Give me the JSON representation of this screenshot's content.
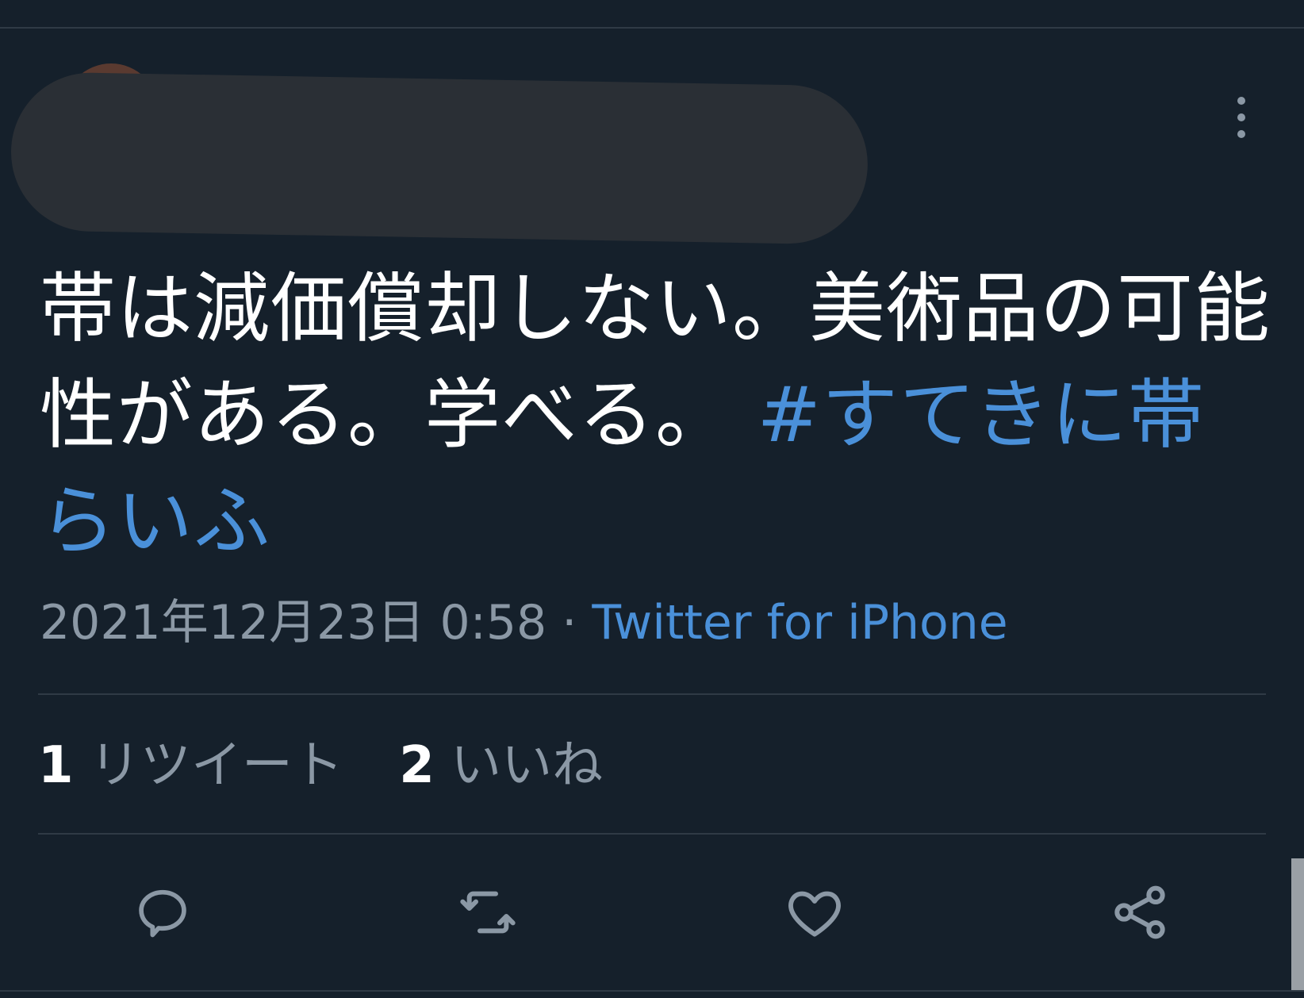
{
  "tweet": {
    "text_part1": "帯は減価償却しない。美術品の可能性がある。学べる。",
    "hashtag": "#すてきに帯らいふ",
    "timestamp": "2021年12月23日 0:58",
    "separator": " · ",
    "source": "Twitter for iPhone"
  },
  "stats": {
    "retweets_count": "1",
    "retweets_label": "リツイート",
    "likes_count": "2",
    "likes_label": "いいね"
  },
  "icons": {
    "more": "more-vertical-icon",
    "reply": "reply-icon",
    "retweet": "retweet-icon",
    "like": "heart-icon",
    "share": "share-icon"
  },
  "colors": {
    "background": "#15202b",
    "link": "#4a90d9",
    "secondary_text": "#8b98a5",
    "divider": "#2f3a45"
  }
}
